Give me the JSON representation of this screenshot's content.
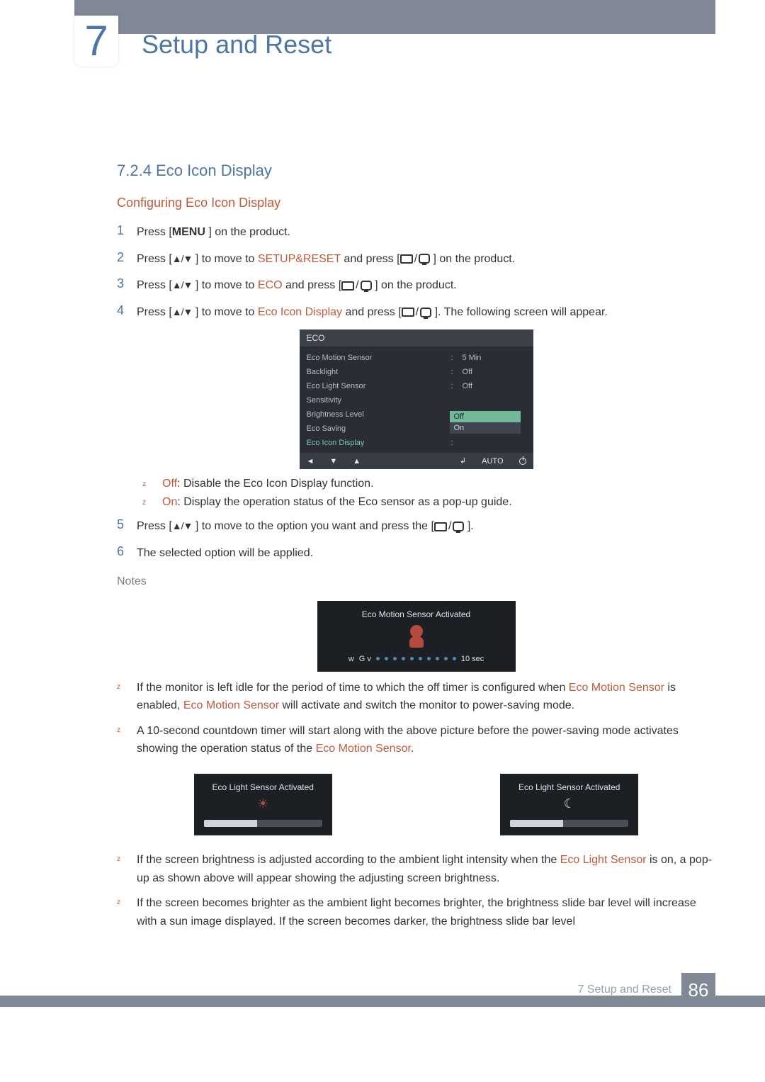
{
  "chapter": {
    "number": "7",
    "title": "Setup and Reset"
  },
  "section": {
    "number_title": "7.2.4  Eco Icon Display",
    "sub_heading": "Configuring Eco Icon Display"
  },
  "steps": {
    "s1_a": "Press [",
    "s1_menu": "MENU",
    "s1_b": " ] on the product.",
    "s2_a": "Press [",
    "s2_b": " ] to move to ",
    "s2_t": "SETUP&RESET",
    "s2_c": " and press [",
    "s2_d": " ] on the product.",
    "s3_a": "Press [",
    "s3_b": " ] to move to ",
    "s3_t": "ECO",
    "s3_c": " and press [",
    "s3_d": " ] on the product.",
    "s4_a": "Press [",
    "s4_b": " ] to move to ",
    "s4_t": "Eco Icon Display",
    "s4_c": " and press [",
    "s4_d": " ]. The following screen will appear.",
    "s5_a": "Press [",
    "s5_b": " ] to move to the option you want and press the [",
    "s5_c": " ].",
    "s6": "The selected option will be applied."
  },
  "osd": {
    "header": "ECO",
    "rows": [
      {
        "label": "Eco Motion Sensor",
        "value": "5 Min",
        "selected": false
      },
      {
        "label": "Backlight",
        "value": "Off",
        "selected": false
      },
      {
        "label": "Eco Light Sensor",
        "value": "Off",
        "selected": false
      },
      {
        "label": "Sensitivity",
        "value": "",
        "selected": false
      },
      {
        "label": "Brightness Level",
        "value": "",
        "selected": false
      },
      {
        "label": "Eco Saving",
        "value": "",
        "selected": false
      },
      {
        "label": "Eco Icon Display",
        "value": "",
        "selected": true
      }
    ],
    "dropdown": [
      "Off",
      "On"
    ],
    "footer": {
      "auto": "AUTO"
    }
  },
  "options": {
    "off_label": "Off",
    "off_text": ": Disable the Eco Icon Display function.",
    "on_label": "On",
    "on_text": ": Display the operation status of the Eco sensor as a pop-up guide."
  },
  "notes_heading": "Notes",
  "popup1": {
    "title": "Eco Motion Sensor Activated",
    "left": "w",
    "gv": "G v",
    "right": "10 sec"
  },
  "popup_light_a": "Eco Light Sensor Activated",
  "popup_light_b": "Eco Light Sensor Activated",
  "note1": {
    "a": "If the monitor is left idle for the period of time to which the off timer is configured when ",
    "t1": "Eco Motion Sensor",
    "b": " is enabled, ",
    "t2": "Eco Motion Sensor",
    "c": " will activate and switch the monitor to power-saving mode."
  },
  "note2": {
    "a": "A 10-second countdown timer will start along with the above picture before the power-saving mode activates showing the operation status of the ",
    "t": "Eco Motion Sensor",
    "b": "."
  },
  "note3": {
    "a": "If the screen brightness is adjusted according to the ambient light intensity when the ",
    "t": "Eco Light Sensor",
    "b": " is on, a pop-up as shown above will appear showing the adjusting screen brightness."
  },
  "note4": {
    "a": "If the screen becomes brighter as the ambient light becomes brighter, the brightness slide bar level will increase with a sun image displayed. If the screen becomes darker, the brightness slide bar level"
  },
  "footer": {
    "text": "7 Setup and Reset",
    "page": "86"
  }
}
